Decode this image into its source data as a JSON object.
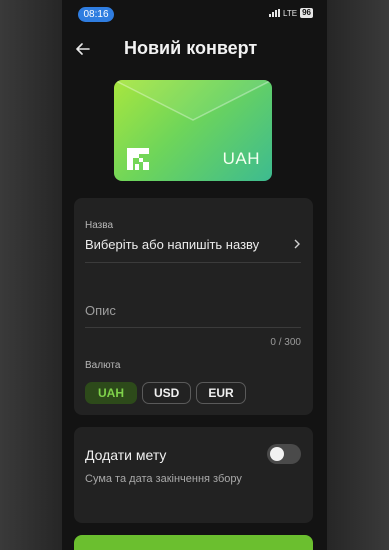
{
  "status_bar": {
    "time": "08:16",
    "network": "LTE",
    "battery": "96"
  },
  "header": {
    "title": "Новий конверт"
  },
  "envelope": {
    "currency": "UAH",
    "gradient_start": "#a8e63f",
    "gradient_end": "#3dbb90"
  },
  "form": {
    "name_label": "Назва",
    "name_value": "Виберіть або напишіть назву",
    "description_placeholder": "Опис",
    "description_counter": "0 / 300",
    "currency_label": "Валюта",
    "currencies": [
      {
        "label": "UAH",
        "selected": true
      },
      {
        "label": "USD",
        "selected": false
      },
      {
        "label": "EUR",
        "selected": false
      }
    ]
  },
  "goal": {
    "title": "Додати мету",
    "subtitle": "Сума та дата закінчення збору",
    "enabled": false
  },
  "colors": {
    "accent": "#6bbf2f",
    "card": "#222222",
    "background": "#131313"
  }
}
